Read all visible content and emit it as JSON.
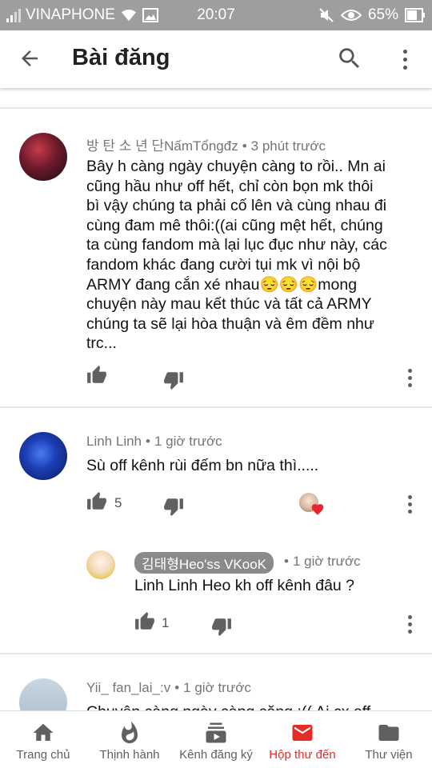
{
  "status_bar": {
    "carrier": "VINAPHONE",
    "time": "20:07",
    "battery": "65%"
  },
  "app_bar": {
    "title": "Bài đăng"
  },
  "comments": [
    {
      "author": "방 탄 소 년 단NấmTổngđz",
      "time": "3 phút trước",
      "text_lines": [
        "Bây h càng ngày chuyện càng to rồi.. Mn ai",
        "cũng hầu như off hết, chỉ còn bọn mk thôi",
        "bì vậy chúng ta phải cố lên và cùng nhau đi",
        "cùng đam mê thôi:((ai cũng mệt hết, chúng",
        "ta cùng fandom mà lại lục đục như này, các",
        "fandom khác đang cười tụi mk vì nội bộ",
        "ARMY đang cắn xé nhau😔😔😔mong",
        "chuyện này mau kết thúc và tất cả ARMY",
        "chúng ta sẽ lại hòa thuận và êm đềm như",
        "trc..."
      ]
    },
    {
      "author": "Linh Linh",
      "time": "1 giờ trước",
      "text": "Sù off kênh rùi đếm bn nữa thì.....",
      "likes": "5"
    },
    {
      "author": "김태형Heo'ss VKooK",
      "time": "1 giờ trước",
      "text": "Linh Linh Heo kh off kênh đâu ?",
      "likes": "1"
    },
    {
      "author": "Yii_ fan_lai_:v",
      "time": "1 giờ trước",
      "text": "Chuyện càng ngày càng căng :(( Ai cx off"
    }
  ],
  "bottom_nav": [
    {
      "label": "Trang chủ",
      "icon": "home-icon"
    },
    {
      "label": "Thịnh hành",
      "icon": "trending-flame-icon"
    },
    {
      "label": "Kênh đăng ký",
      "icon": "subscriptions-icon"
    },
    {
      "label": "Hộp thư đến",
      "icon": "inbox-mail-icon"
    },
    {
      "label": "Thư viện",
      "icon": "library-folder-icon"
    }
  ],
  "colors": {
    "accent": "#e52d27",
    "status_bar": "#9e9e9e",
    "meta_text": "#757575"
  }
}
